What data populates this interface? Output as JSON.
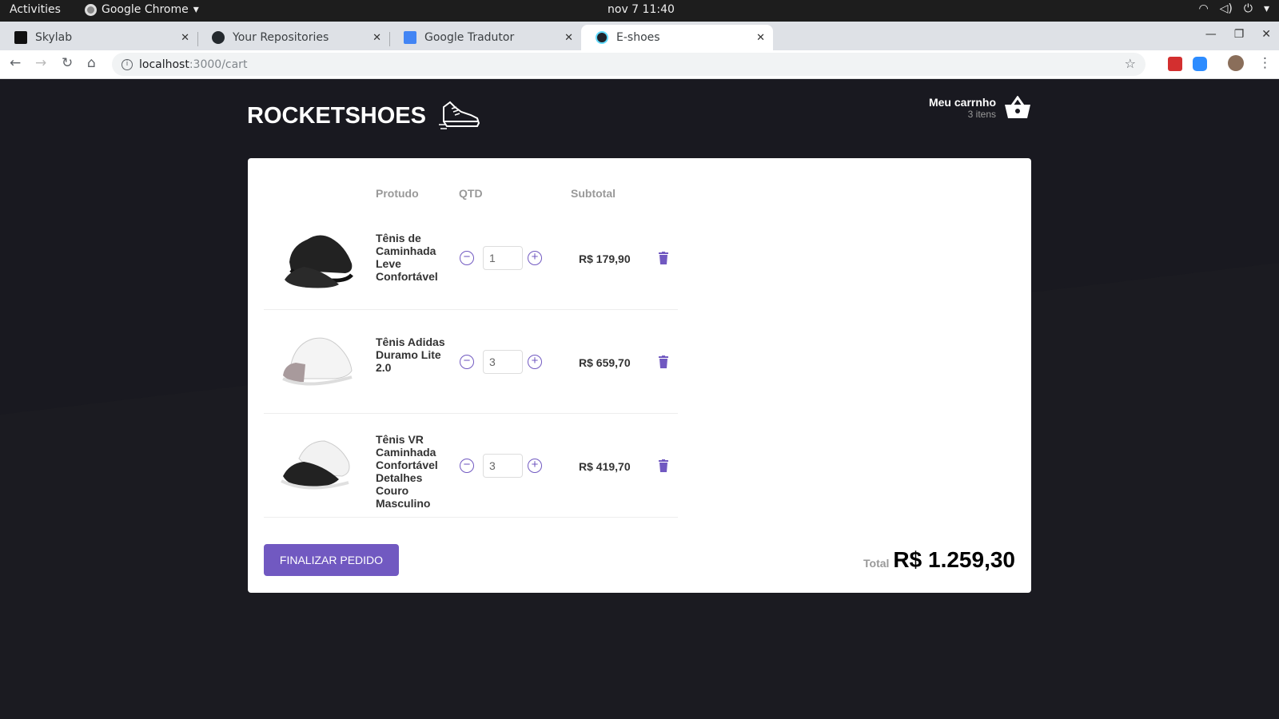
{
  "os": {
    "activities": "Activities",
    "app_name": "Google Chrome",
    "clock": "nov 7  11:40"
  },
  "browser": {
    "tabs": [
      {
        "title": "Skylab",
        "favicon": "skylab-icon",
        "active": false
      },
      {
        "title": "Your Repositories",
        "favicon": "github-icon",
        "active": false
      },
      {
        "title": "Google Tradutor",
        "favicon": "google-translate-icon",
        "active": false
      },
      {
        "title": "E-shoes",
        "favicon": "react-icon",
        "active": true
      }
    ],
    "url_host": "localhost",
    "url_path": ":3000/cart"
  },
  "header": {
    "logo_text": "ROCKETSHOES",
    "cart_title": "Meu carrnho",
    "cart_count": "3 itens"
  },
  "cart": {
    "columns": {
      "product": "Protudo",
      "qty": "QTD",
      "subtotal": "Subtotal"
    },
    "items": [
      {
        "name": "Tênis de Caminhada Leve Confortável",
        "quantity": "1",
        "subtotal": "R$ 179,90",
        "shoe_color": "black"
      },
      {
        "name": "Tênis Adidas Duramo Lite 2.0",
        "quantity": "3",
        "subtotal": "R$ 659,70",
        "shoe_color": "white"
      },
      {
        "name": "Tênis VR Caminhada Confortável Detalhes Couro Masculino",
        "quantity": "3",
        "subtotal": "R$ 419,70",
        "shoe_color": "black-white"
      }
    ],
    "checkout_label": "FINALIZAR PEDIDO",
    "total_label": "Total",
    "total_value": "R$ 1.259,30"
  },
  "colors": {
    "accent": "#7159c1",
    "page_bg": "#191920"
  }
}
